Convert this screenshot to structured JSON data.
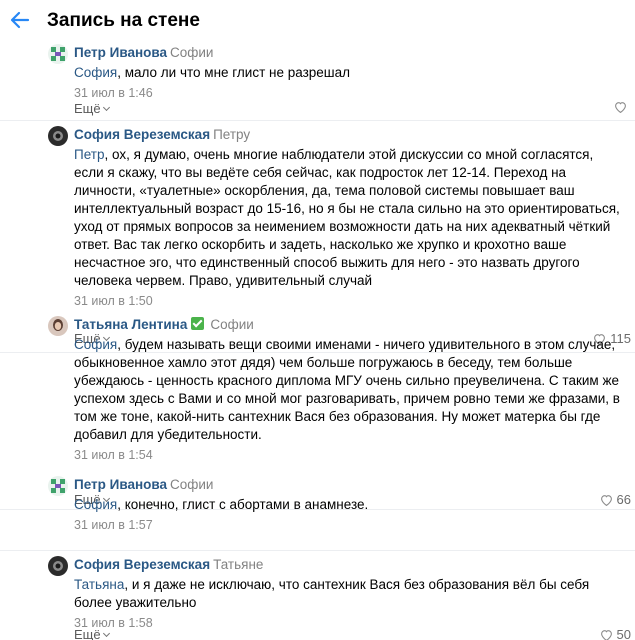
{
  "header": {
    "title": "Запись на стене"
  },
  "comments": [
    {
      "author": "Петр Иванова",
      "reply_to": "Софии",
      "mention": "София",
      "text": ", мало ли что мне глист не разрешал",
      "date": "31 июл в 1:46",
      "more": "Ещё",
      "likes": ""
    },
    {
      "author": "София Вереземская",
      "reply_to": "Петру",
      "mention": "Петр",
      "text": ", ох, я думаю, очень многие наблюдатели этой дискуссии со мной согласятся, если я скажу, что вы ведёте себя сейчас, как подросток лет 12-14. Переход на личности, «туалетные» оскорбления, да, тема половой системы повышает ваш интеллектуальный возраст до 15-16, но я бы не стала сильно на это ориентироваться, уход от прямых вопросов за неимением возможности дать на них адекватный чёткий ответ. Вас так легко оскорбить и задеть, насколько же хрупко и крохотно ваше несчастное эго, что единственный способ выжить для него - это назвать другого человека червем. Право, удивительный случай",
      "date": "31 июл в 1:50",
      "more": "Ещё",
      "likes": "115"
    },
    {
      "author": "Татьяна Лентина",
      "reply_to": "Софии",
      "mention": "София",
      "text": ", будем называть вещи своими именами - ничего удивительного в этом случае, обыкновенное хамло этот дядя) чем больше погружаюсь в беседу, тем больше убеждаюсь - ценность красного диплома МГУ очень сильно преувеличена. С таким же успехом здесь с Вами и со мной мог разговаривать, причем ровно теми же фразами, в том же тоне, какой-нить сантехник Вася без образования. Ну может матерка бы где добавил для убедительности.",
      "date": "31 июл в 1:54",
      "more": "Ещё",
      "likes": "66"
    },
    {
      "author": "Петр Иванова",
      "reply_to": "Софии",
      "mention": "София",
      "text": ", конечно, глист с абортами в анамнезе.",
      "date": "31 июл в 1:57",
      "more": "Ещё",
      "likes": ""
    },
    {
      "author": "София Вереземская",
      "reply_to": "Татьяне",
      "mention": "Татьяна",
      "text": ", и я даже не исключаю, что сантехник Вася без образования вёл бы себя более уважительно",
      "date": "31 июл в 1:58",
      "more": "Ещё",
      "likes": "50"
    }
  ],
  "icons": {
    "back": "arrow-left-icon",
    "like": "heart-icon",
    "more": "chevron-down-icon",
    "verified": "verified-check-icon"
  },
  "colors": {
    "accent": "#2a5885",
    "back_arrow": "#2787f5",
    "secondary": "#828282",
    "verified": "#4bb34b"
  }
}
